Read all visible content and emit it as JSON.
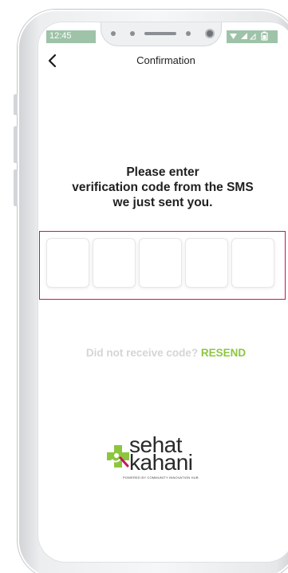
{
  "status_bar": {
    "time": "12:45",
    "icons": [
      "wifi-icon",
      "signal-icon",
      "battery-icon"
    ]
  },
  "header": {
    "back_icon": "chevron-left-icon",
    "title": "Confirmation"
  },
  "instruction": {
    "line1": "Please enter",
    "line2": "verification code from the SMS",
    "line3": "we just sent you."
  },
  "otp": {
    "digits": [
      "",
      "",
      "",
      "",
      ""
    ],
    "border_color": "#c2185b"
  },
  "resend": {
    "question": "Did not receive code?",
    "link": "RESEND",
    "link_color": "#8cc63f"
  },
  "brand": {
    "name_line1": "sehat",
    "name_line2": "kahani",
    "tagline": "POWERED BY COMMUNITY INNOVATION HUB",
    "accent_green": "#8cc63f",
    "accent_magenta": "#c2185b"
  }
}
